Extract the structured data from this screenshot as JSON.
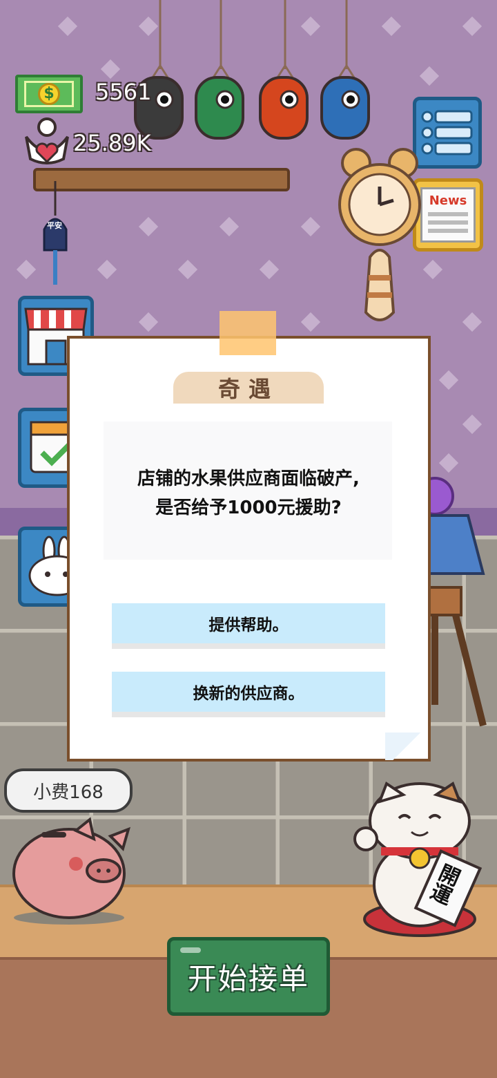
{
  "hud": {
    "money": "5561",
    "fans": "25.89K",
    "money_icon": "dollar-bill-icon",
    "fans_icon": "heart-person-icon"
  },
  "dialog": {
    "title": "奇遇",
    "question_line1": "店铺的水果供应商面临破产,",
    "question_line2": "是否给予1000元援助?",
    "options": [
      {
        "label": "提供帮助。"
      },
      {
        "label": "换新的供应商。"
      }
    ]
  },
  "counter": {
    "tip_label": "小费168"
  },
  "actions": {
    "start_label": "开始接单"
  },
  "decor": {
    "charm_text": "平安",
    "news_text": "News",
    "cat_sign": "開運"
  },
  "colors": {
    "wall": "#a88ab2",
    "dialog_border": "#7a4f2c",
    "option_bg": "#c9ebfc",
    "start_button": "#3a8a55"
  }
}
